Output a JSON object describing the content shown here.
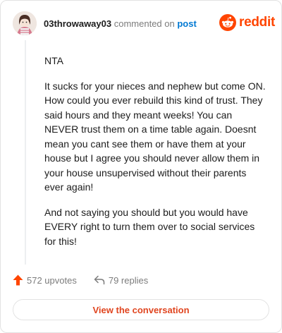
{
  "header": {
    "username": "03throwaway03",
    "action": "commented on",
    "link": "post"
  },
  "brand": {
    "name": "reddit",
    "color": "#ff4500",
    "icon": "reddit-snoo-icon"
  },
  "comment": {
    "paragraphs": [
      "NTA",
      "It sucks for your nieces and nephew but come ON. How could you ever rebuild this kind of trust. They said hours and they meant weeks! You can NEVER trust them on a time table again. Doesnt mean you cant see them or have them at your house but I agree you should never allow them in your house unsupervised without their parents ever again!",
      "And not saying you should but you would have EVERY right to turn them over to social services for this!"
    ]
  },
  "stats": {
    "upvotes": "572 upvotes",
    "replies": "79 replies",
    "upvote_icon": "upvote-arrow-icon",
    "reply_icon": "reply-arrow-icon",
    "upvote_color": "#ff4500"
  },
  "cta": {
    "label": "View the conversation",
    "color": "#e0451f"
  }
}
